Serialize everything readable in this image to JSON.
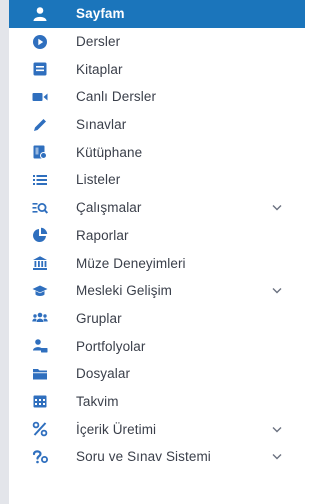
{
  "colors": {
    "accent": "#1b75bb",
    "icon": "#2f6fbe",
    "text": "#3a3f4a",
    "active_text": "#ffffff"
  },
  "menu": [
    {
      "label": "Sayfam",
      "icon": "user-icon",
      "active": true,
      "expandable": false
    },
    {
      "label": "Dersler",
      "icon": "play-circle-icon",
      "active": false,
      "expandable": false
    },
    {
      "label": "Kitaplar",
      "icon": "book-icon",
      "active": false,
      "expandable": false
    },
    {
      "label": "Canlı Dersler",
      "icon": "video-camera-icon",
      "active": false,
      "expandable": false
    },
    {
      "label": "Sınavlar",
      "icon": "pencil-icon",
      "active": false,
      "expandable": false
    },
    {
      "label": "Kütüphane",
      "icon": "library-icon",
      "active": false,
      "expandable": false
    },
    {
      "label": "Listeler",
      "icon": "list-icon",
      "active": false,
      "expandable": false
    },
    {
      "label": "Çalışmalar",
      "icon": "search-list-icon",
      "active": false,
      "expandable": true
    },
    {
      "label": "Raporlar",
      "icon": "pie-chart-icon",
      "active": false,
      "expandable": false
    },
    {
      "label": "Müze Deneyimleri",
      "icon": "museum-icon",
      "active": false,
      "expandable": false
    },
    {
      "label": "Mesleki Gelişim",
      "icon": "graduation-cap-icon",
      "active": false,
      "expandable": true
    },
    {
      "label": "Gruplar",
      "icon": "users-icon",
      "active": false,
      "expandable": false
    },
    {
      "label": "Portfolyolar",
      "icon": "user-folder-icon",
      "active": false,
      "expandable": false
    },
    {
      "label": "Dosyalar",
      "icon": "folder-icon",
      "active": false,
      "expandable": false
    },
    {
      "label": "Takvim",
      "icon": "calendar-icon",
      "active": false,
      "expandable": false
    },
    {
      "label": "İçerik Üretimi",
      "icon": "percent-icon",
      "active": false,
      "expandable": true
    },
    {
      "label": "Soru ve Sınav Sistemi",
      "icon": "question-icon",
      "active": false,
      "expandable": true
    }
  ]
}
